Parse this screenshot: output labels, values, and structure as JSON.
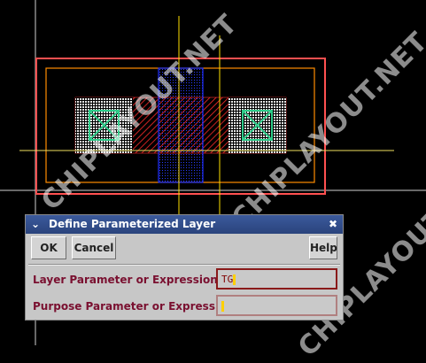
{
  "watermark": "CHIPLAYOUT.NET",
  "colors": {
    "background": "#000000",
    "boundary": "#ff4040",
    "nwell": "#ff8c00",
    "poly": "#1a2cff",
    "diffusion": "#ff2020",
    "contact": "#2ecc8a",
    "crosshair_v": "#ffe000",
    "titlebar": "#2f4a88"
  },
  "dialog": {
    "title": "Define Parameterized Layer",
    "menu_icon": "chevron-down-icon",
    "close_icon": "close-icon",
    "buttons": {
      "ok": "OK",
      "cancel": "Cancel",
      "help": "Help"
    },
    "fields": {
      "layer_label": "Layer Parameter or Expression",
      "layer_value": "TG",
      "purpose_label": "Purpose Parameter or Expression",
      "purpose_value": ""
    }
  }
}
